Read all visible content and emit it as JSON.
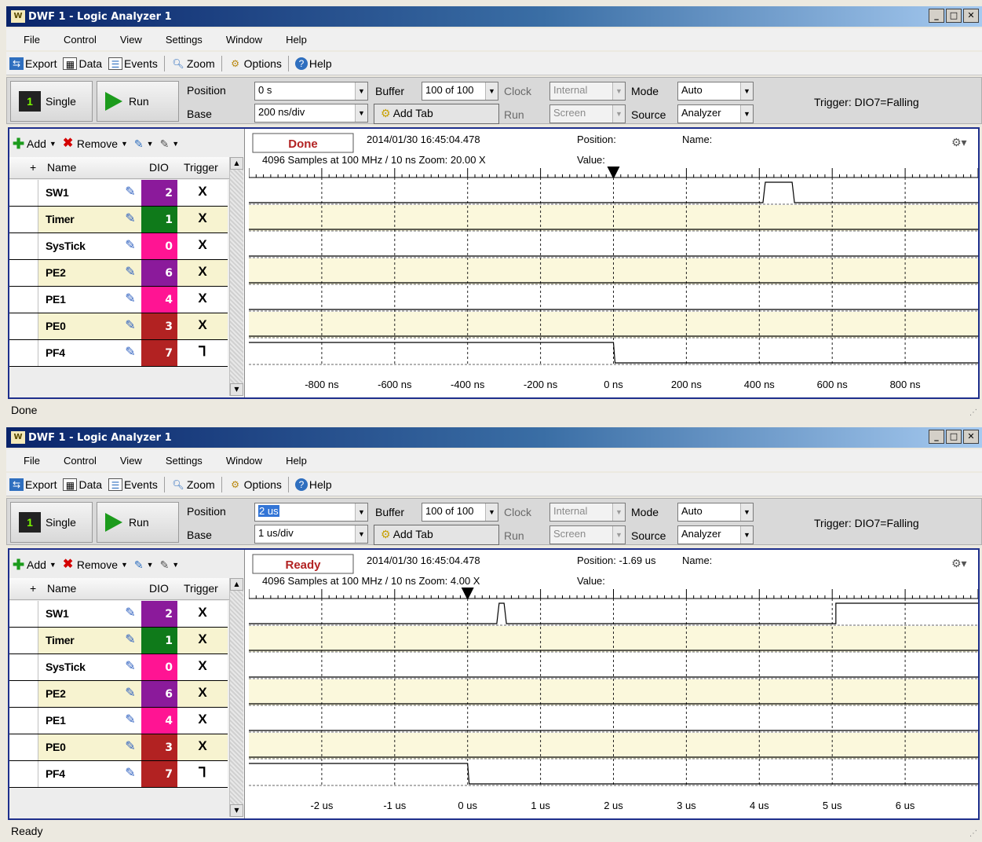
{
  "windows": [
    {
      "title": "DWF 1 - Logic Analyzer 1",
      "app_icon": "W",
      "window_buttons": [
        "_",
        "□",
        "✕"
      ],
      "menu": [
        "File",
        "Control",
        "View",
        "Settings",
        "Window",
        "Help"
      ],
      "toolbar": {
        "export": "Export",
        "data": "Data",
        "events": "Events",
        "zoom": "Zoom",
        "options": "Options",
        "help": "Help"
      },
      "controls": {
        "single": "Single",
        "run_btn": "Run",
        "position_label": "Position",
        "position_value": "0 s",
        "base_label": "Base",
        "base_value": "200 ns/div",
        "buffer_label": "Buffer",
        "buffer_value": "100 of 100",
        "add_tab": "Add Tab",
        "clock_label": "Clock",
        "clock_value": "Internal",
        "run_label": "Run",
        "run_value": "Screen",
        "mode_label": "Mode",
        "mode_value": "Auto",
        "source_label": "Source",
        "source_value": "Analyzer",
        "trigger_info": "Trigger: DIO7=Falling"
      },
      "channel_toolbar": {
        "add": "Add",
        "remove": "Remove"
      },
      "columns": {
        "plus": "+",
        "name": "Name",
        "dio": "DIO",
        "trigger": "Trigger"
      },
      "channels": [
        {
          "name": "SW1",
          "dio": "2",
          "trigger": "X",
          "color": "#8b1a9b"
        },
        {
          "name": "Timer",
          "dio": "1",
          "trigger": "X",
          "color": "#0f7a1a"
        },
        {
          "name": "SysTick",
          "dio": "0",
          "trigger": "X",
          "color": "#ff1493"
        },
        {
          "name": "PE2",
          "dio": "6",
          "trigger": "X",
          "color": "#8b1a9b"
        },
        {
          "name": "PE1",
          "dio": "4",
          "trigger": "X",
          "color": "#ff1493"
        },
        {
          "name": "PE0",
          "dio": "3",
          "trigger": "X",
          "color": "#b22222"
        },
        {
          "name": "PF4",
          "dio": "7",
          "trigger": "⅂",
          "color": "#b22222"
        }
      ],
      "acq": {
        "state": "Done",
        "state_color": "#b22222",
        "datetime": "2014/01/30  16:45:04.478",
        "position": "Position:",
        "name": "Name:",
        "samples": "4096 Samples at 100 MHz / 10 ns Zoom: 20.00 X",
        "value": "Value:"
      },
      "x_ticks": [
        "-800 ns",
        "-600 ns",
        "-400 ns",
        "-200 ns",
        "0 ns",
        "200 ns",
        "400 ns",
        "600 ns",
        "800 ns"
      ],
      "trigger_marker_div": 5,
      "pf4_fall_div": 5,
      "sw1_pulse_div": [
        7.05,
        7.45
      ],
      "status": "Done"
    },
    {
      "title": "DWF 1 - Logic Analyzer 1",
      "app_icon": "W",
      "window_buttons": [
        "_",
        "□",
        "✕"
      ],
      "menu": [
        "File",
        "Control",
        "View",
        "Settings",
        "Window",
        "Help"
      ],
      "toolbar": {
        "export": "Export",
        "data": "Data",
        "events": "Events",
        "zoom": "Zoom",
        "options": "Options",
        "help": "Help"
      },
      "controls": {
        "single": "Single",
        "run_btn": "Run",
        "position_label": "Position",
        "position_value": "2 us",
        "base_label": "Base",
        "base_value": "1 us/div",
        "buffer_label": "Buffer",
        "buffer_value": "100 of 100",
        "add_tab": "Add Tab",
        "clock_label": "Clock",
        "clock_value": "Internal",
        "run_label": "Run",
        "run_value": "Screen",
        "mode_label": "Mode",
        "mode_value": "Auto",
        "source_label": "Source",
        "source_value": "Analyzer",
        "trigger_info": "Trigger: DIO7=Falling"
      },
      "channel_toolbar": {
        "add": "Add",
        "remove": "Remove"
      },
      "columns": {
        "plus": "+",
        "name": "Name",
        "dio": "DIO",
        "trigger": "Trigger"
      },
      "channels": [
        {
          "name": "SW1",
          "dio": "2",
          "trigger": "X",
          "color": "#8b1a9b"
        },
        {
          "name": "Timer",
          "dio": "1",
          "trigger": "X",
          "color": "#0f7a1a"
        },
        {
          "name": "SysTick",
          "dio": "0",
          "trigger": "X",
          "color": "#ff1493"
        },
        {
          "name": "PE2",
          "dio": "6",
          "trigger": "X",
          "color": "#8b1a9b"
        },
        {
          "name": "PE1",
          "dio": "4",
          "trigger": "X",
          "color": "#ff1493"
        },
        {
          "name": "PE0",
          "dio": "3",
          "trigger": "X",
          "color": "#b22222"
        },
        {
          "name": "PF4",
          "dio": "7",
          "trigger": "⅂",
          "color": "#b22222"
        }
      ],
      "acq": {
        "state": "Ready",
        "state_color": "#b22222",
        "datetime": "2014/01/30  16:45:04.478",
        "position": "Position: -1.69 us",
        "name": "Name:",
        "samples": "4096 Samples at 100 MHz / 10 ns Zoom: 4.00 X",
        "value": "Value:"
      },
      "x_ticks": [
        "-2 us",
        "-1 us",
        "0 us",
        "1 us",
        "2 us",
        "3 us",
        "4 us",
        "5 us",
        "6 us"
      ],
      "trigger_marker_div": 3,
      "pf4_fall_div": 3,
      "sw1_pulse_div": [
        3.4,
        3.5
      ],
      "sw1_rise_div": 8.05,
      "status": "Ready"
    }
  ]
}
